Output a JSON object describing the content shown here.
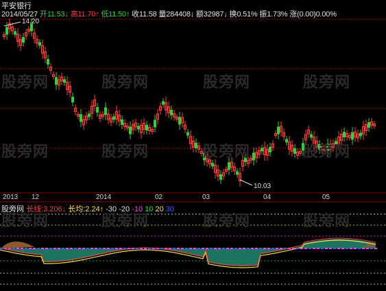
{
  "colors": {
    "up": "#ff3c3c",
    "down": "#2fd13a",
    "grid": "#b00000",
    "label": "#c0c0c0",
    "text": "#e0e0e0",
    "watermark": "#2b2b2b",
    "yellow": "#ffe14a",
    "magenta": "#ff3cff",
    "blue": "#3c5cff",
    "teal": "#2aa39a"
  },
  "header": {
    "stock_name": "平安银行",
    "date": "2014/05/27",
    "open_label": "开",
    "open_value": "11.53",
    "open_arrow": "↓",
    "high_label": "高",
    "high_value": "11.70",
    "high_arrow": "↑",
    "low_label": "低",
    "low_value": "11.50",
    "low_arrow": "↑",
    "close_label": "收",
    "close_value": "11.58",
    "volume_label": "量",
    "volume_value": "284408",
    "volume_arrow": "↓",
    "amount_label": "额",
    "amount_value": "32987",
    "amount_arrow": "↓",
    "turnover_label": "换",
    "turnover_value": "0.51%",
    "amplitude_label": "振",
    "amplitude_value": "1.73%",
    "change_label": "涨",
    "change_value": "(0.00)",
    "change_pct": "0.00%"
  },
  "price_chart": {
    "high_marker": "14.20",
    "low_marker": "10.03"
  },
  "date_axis": {
    "ticks": [
      "2013",
      "12",
      "2014",
      "02",
      "03",
      "04",
      "05"
    ]
  },
  "indicator": {
    "name": "股旁网",
    "long_line_label": "长线:",
    "long_line_value": "3.206",
    "long_line_arrow": "↓",
    "long_avg_label": "长均:",
    "long_avg_value": "2.24",
    "long_avg_arrow": "↑",
    "levels": [
      "-30",
      "-20",
      "-10",
      "10",
      "20",
      "30"
    ]
  },
  "watermark": {
    "text": "股旁网"
  }
}
